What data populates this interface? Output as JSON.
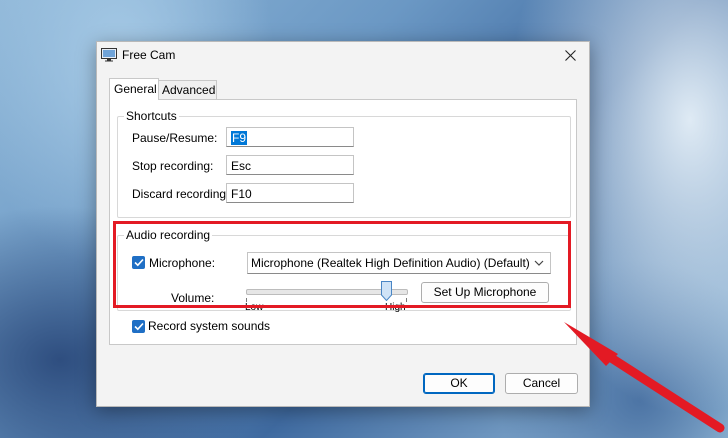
{
  "window": {
    "title": "Free Cam",
    "app_icon": "monitor-icon",
    "close_icon": "close-icon"
  },
  "tabs": [
    {
      "label": "General",
      "active": true
    },
    {
      "label": "Advanced",
      "active": false
    }
  ],
  "shortcuts": {
    "group_title": "Shortcuts",
    "pause_resume": {
      "label": "Pause/Resume:",
      "value": "F9"
    },
    "stop_recording": {
      "label": "Stop recording:",
      "value": "Esc"
    },
    "discard_recording": {
      "label": "Discard recording:",
      "value": "F10"
    }
  },
  "audio": {
    "group_title": "Audio recording",
    "microphone_checkbox": {
      "label": "Microphone:",
      "checked": true
    },
    "microphone_device": "Microphone (Realtek High Definition Audio) (Default)",
    "volume_label": "Volume:",
    "volume_low": "Low",
    "volume_high": "High",
    "volume_level": 0.88,
    "setup_button": "Set Up Microphone"
  },
  "system_sounds": {
    "label": "Record system sounds",
    "checked": true
  },
  "buttons": {
    "ok": "OK",
    "cancel": "Cancel"
  },
  "colors": {
    "accent": "#0067c0",
    "highlight": "#e31a24"
  }
}
